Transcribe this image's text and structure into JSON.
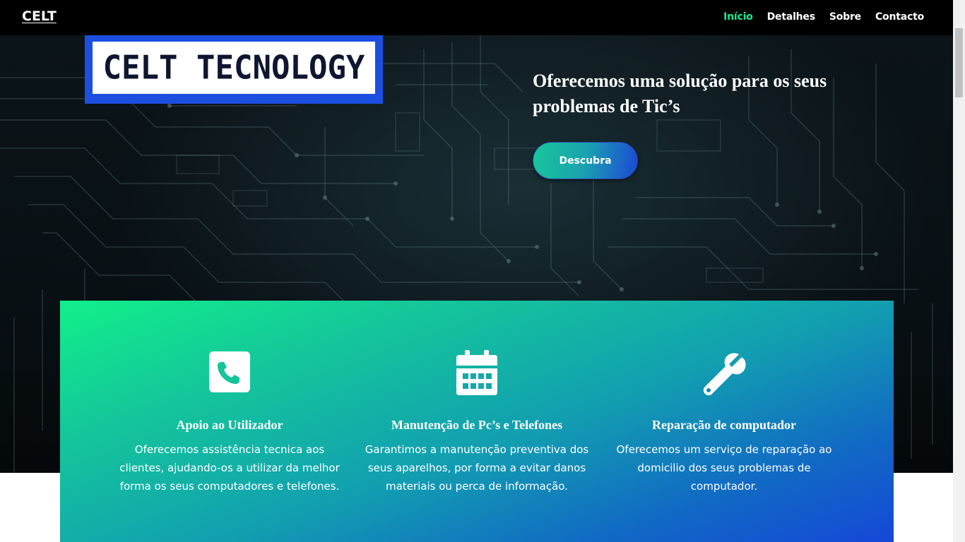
{
  "navbar": {
    "brand": "CELT",
    "links": [
      "Início",
      "Detalhes",
      "Sobre",
      "Contacto"
    ],
    "active_color": "#1ee88f"
  },
  "hero": {
    "logo_text": "CELT TECNOLOGY",
    "title_line1": "Oferecemos uma solução para os seus",
    "title_line2": "problemas de Tic’s",
    "cta_label": "Descubra"
  },
  "features": [
    {
      "icon": "phone-square-icon",
      "title": "Apoio ao Utilizador",
      "text": "Oferecemos assistência tecnica aos clientes, ajudando-os a utilizar da melhor forma os seus computadores e telefones."
    },
    {
      "icon": "calendar-icon",
      "title": "Manutenção de Pc’s e Telefones",
      "text": "Garantimos a manutenção preventiva dos seus aparelhos, por forma a evitar danos materiais ou perca de informação."
    },
    {
      "icon": "wrench-icon",
      "title": "Reparação de computador",
      "text": "Oferecemos um serviço de reparação ao domicilio dos seus problemas de computador."
    }
  ],
  "colors": {
    "logo_border": "#1c4fe0",
    "panel_gradient_start": "#11f08a",
    "panel_gradient_end": "#1548d8"
  }
}
